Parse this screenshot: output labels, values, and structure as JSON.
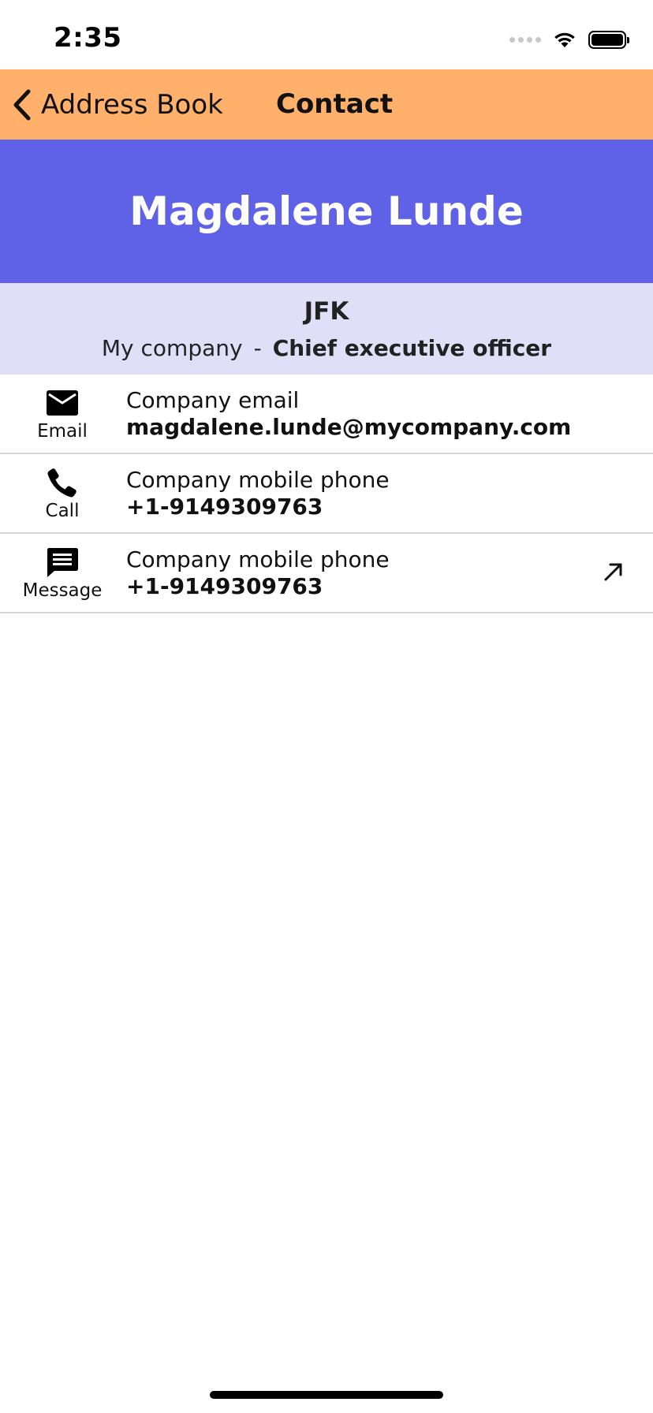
{
  "status_bar": {
    "time": "2:35",
    "icons": [
      "signal-icon",
      "wifi-icon",
      "battery-icon"
    ]
  },
  "nav": {
    "back_label": "Address Book",
    "title": "Contact",
    "background_color": "#ffb06a"
  },
  "contact": {
    "name": "Magdalene Lunde",
    "banner_color": "#5f61e6",
    "location": "JFK",
    "company": "My company",
    "separator": "-",
    "role": "Chief executive officer",
    "info_background_color": "#dfdff8"
  },
  "actions": [
    {
      "icon": "email-icon",
      "action_label": "Email",
      "field_label": "Company email",
      "value": "magdalene.lunde@mycompany.com"
    },
    {
      "icon": "phone-icon",
      "action_label": "Call",
      "field_label": "Company mobile phone",
      "value": "+1-9149309763"
    },
    {
      "icon": "message-icon",
      "action_label": "Message",
      "field_label": "Company mobile phone",
      "value": "+1-9149309763",
      "trailing_icon": "external-link-arrow-icon"
    }
  ]
}
